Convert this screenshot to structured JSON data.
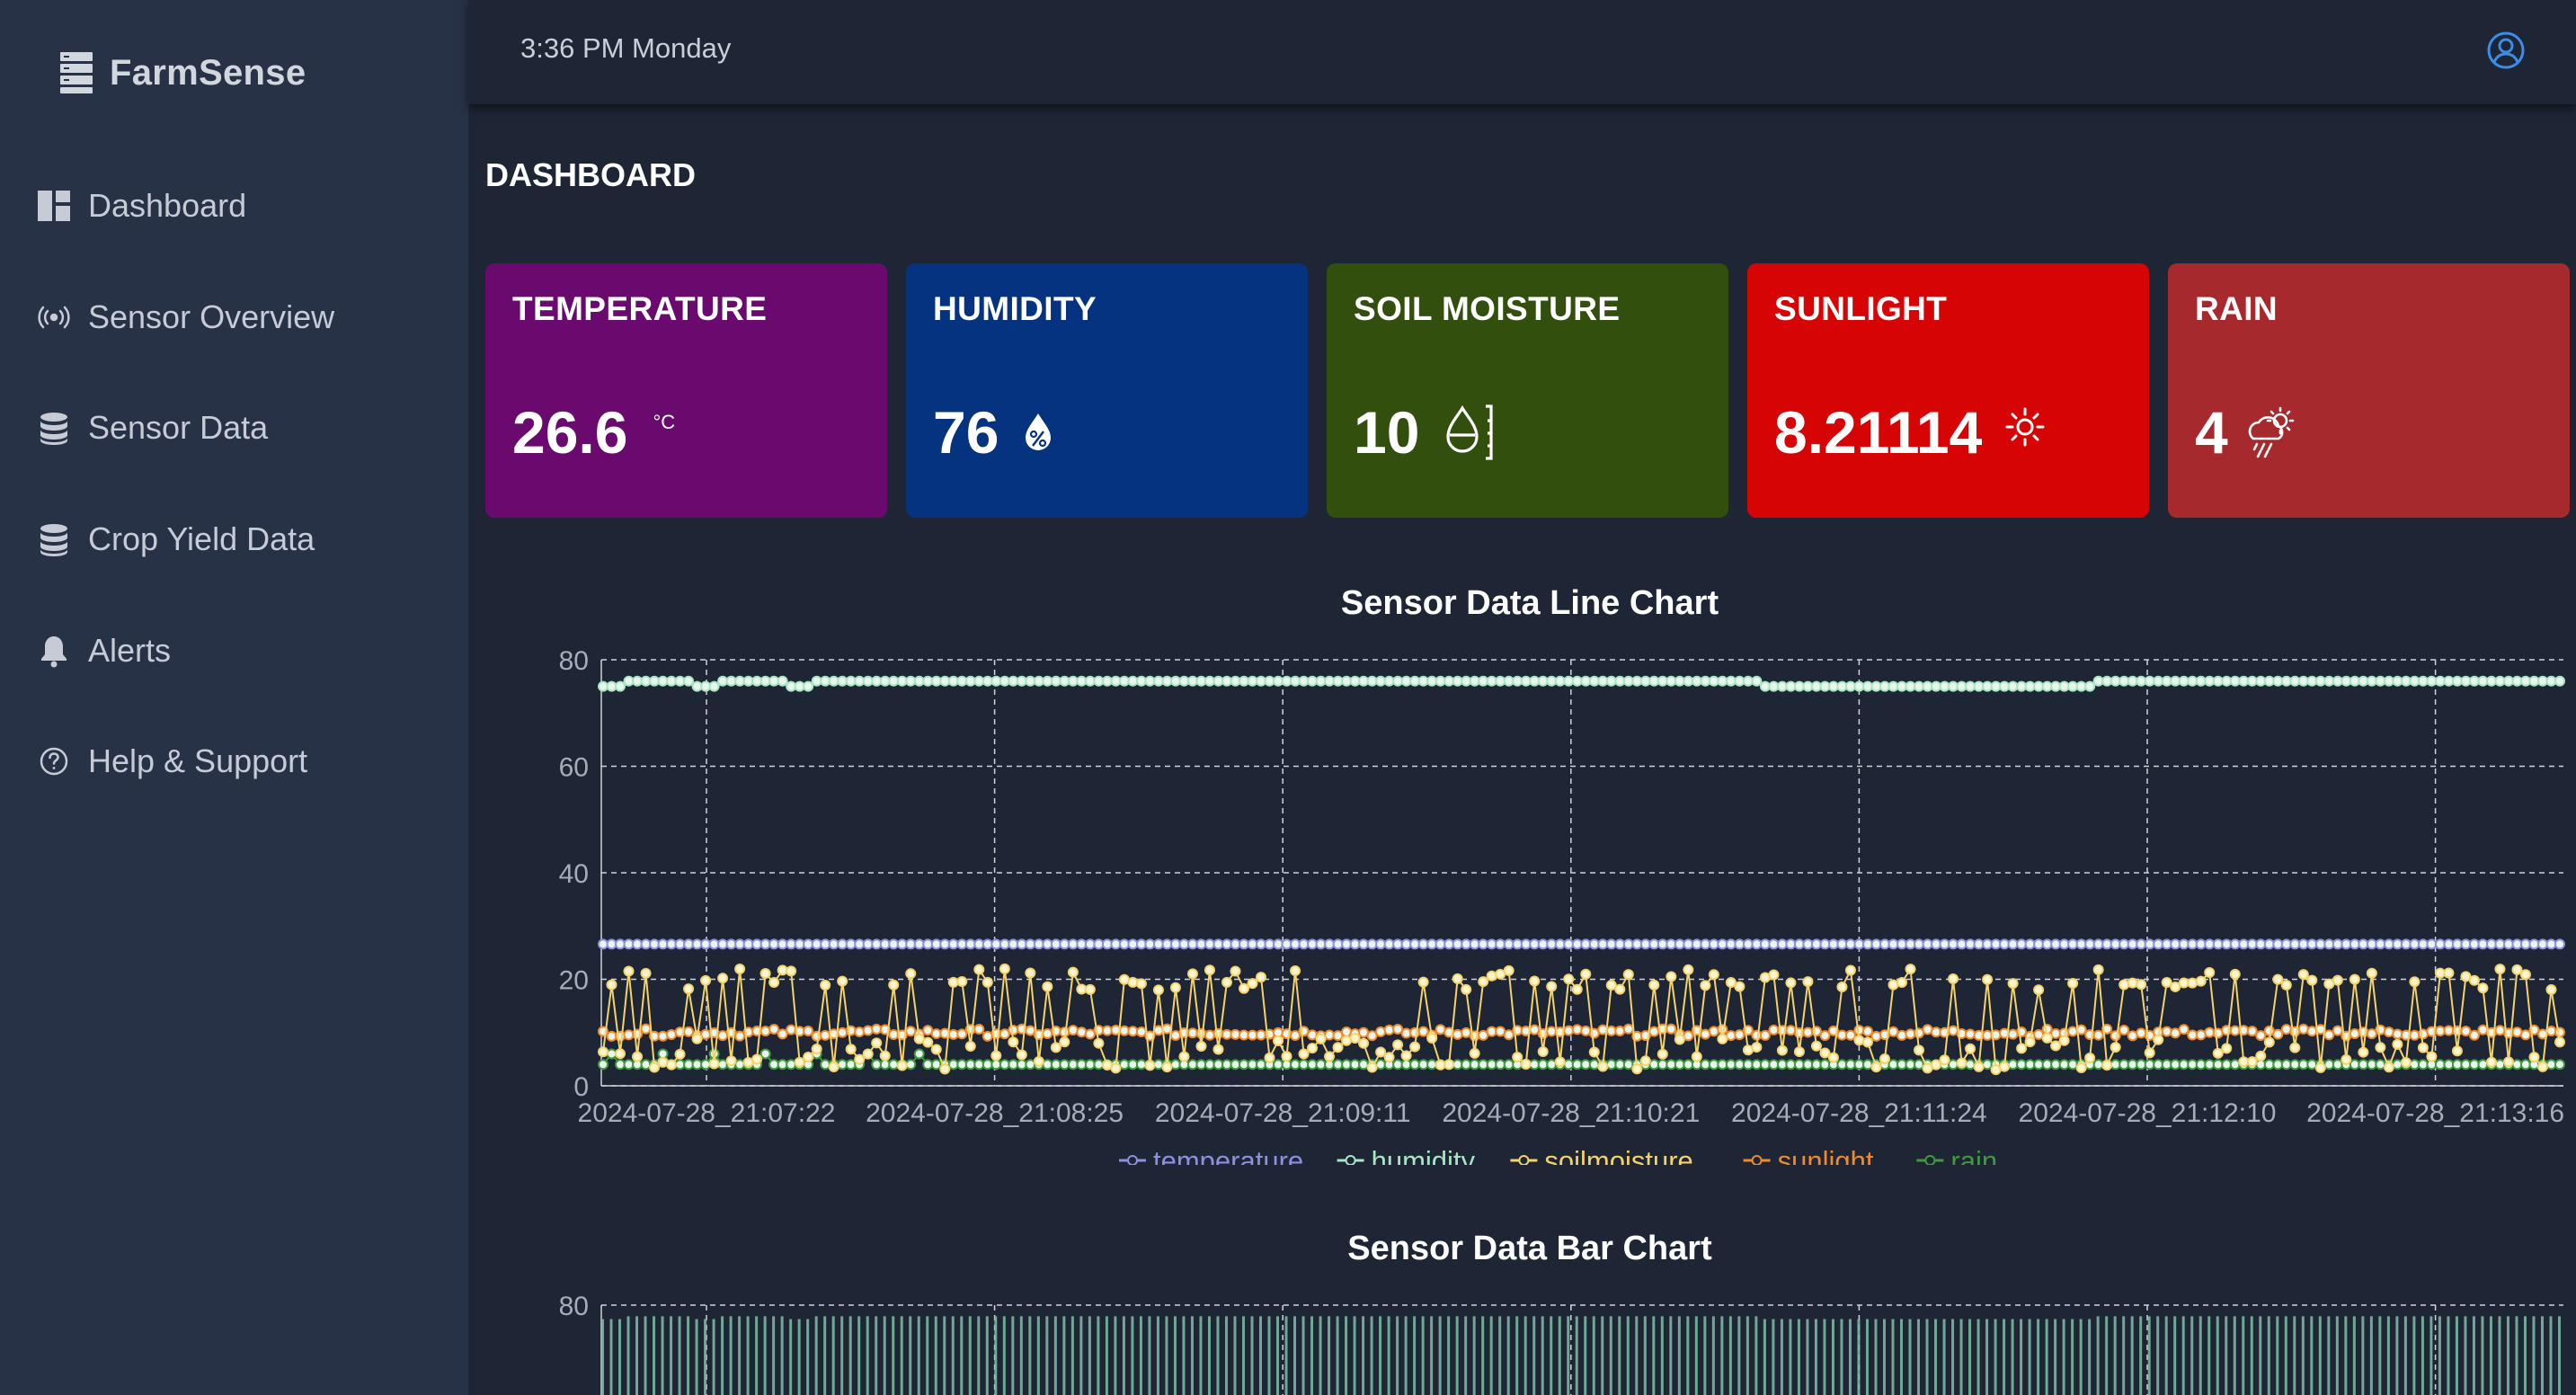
{
  "sidebar": {
    "brand": "FarmSense",
    "items": [
      {
        "label": "Dashboard",
        "icon": "dashboard-icon"
      },
      {
        "label": "Sensor Overview",
        "icon": "sensor-broadcast-icon"
      },
      {
        "label": "Sensor Data",
        "icon": "database-icon"
      },
      {
        "label": "Crop Yield Data",
        "icon": "database-icon"
      },
      {
        "label": "Alerts",
        "icon": "bell-icon"
      },
      {
        "label": "Help & Support",
        "icon": "question-circle-icon"
      }
    ]
  },
  "header": {
    "clock": "3:36 PM Monday",
    "user_icon": "user-circle-icon"
  },
  "page_title": "DASHBOARD",
  "cards": [
    {
      "title": "TEMPERATURE",
      "value": "26.6",
      "unit": "°C",
      "color": "#6a0a6f",
      "icon": "celsius-icon"
    },
    {
      "title": "HUMIDITY",
      "value": "76",
      "color": "#06337f",
      "icon": "humidity-drop-icon"
    },
    {
      "title": "SOIL MOISTURE",
      "value": "10",
      "color": "#334f0d",
      "icon": "soil-moisture-drop-icon"
    },
    {
      "title": "SUNLIGHT",
      "value": "8.21114",
      "color": "#d60404",
      "icon": "sun-icon"
    },
    {
      "title": "RAIN",
      "value": "4",
      "color": "#a62a2d",
      "icon": "rain-cloud-icon"
    }
  ],
  "chart_data": [
    {
      "type": "line",
      "title": "Sensor Data Line Chart",
      "ylim": [
        0,
        80
      ],
      "yticks": [
        0,
        20,
        40,
        60,
        80
      ],
      "x_tick_labels": [
        "2024-07-28_21:07:22",
        "2024-07-28_21:08:25",
        "2024-07-28_21:09:11",
        "2024-07-28_21:10:21",
        "2024-07-28_21:11:24",
        "2024-07-28_21:12:10",
        "2024-07-28_21:13:16"
      ],
      "grid": true,
      "legend": "bottom",
      "series": [
        {
          "name": "temperature",
          "color": "#8f8fe0",
          "approx_value": 26.6
        },
        {
          "name": "humidity",
          "color": "#a8e6c4",
          "approx_value": 76
        },
        {
          "name": "soilmoisture",
          "color": "#f5d36b",
          "range": [
            0,
            23
          ]
        },
        {
          "name": "sunlight",
          "color": "#f08a2a",
          "approx_value": 10
        },
        {
          "name": "rain",
          "color": "#3d9a3d",
          "approx_value": 4
        }
      ]
    },
    {
      "type": "bar",
      "title": "Sensor Data Bar Chart",
      "ylim": [
        0,
        80
      ],
      "yticks": [
        80
      ],
      "grid": true
    }
  ]
}
